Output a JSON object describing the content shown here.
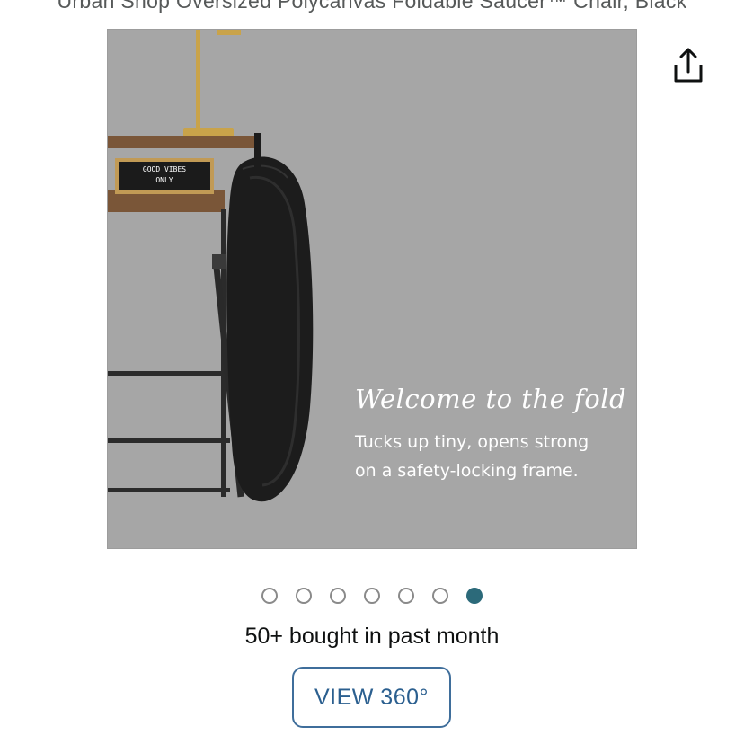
{
  "product": {
    "title": "Urban Shop Oversized Polycanvas Foldable Saucer™ Chair, Black"
  },
  "share": {
    "icon": "share-icon"
  },
  "image": {
    "sign_text": "GOOD VIBES ONLY",
    "overlay_heading": "Welcome to the fold",
    "overlay_line1": "Tucks up tiny, opens strong",
    "overlay_line2": "on a safety-locking frame."
  },
  "carousel": {
    "total": 7,
    "active_index": 6,
    "active_color": "#2c6a7a"
  },
  "social_proof": {
    "text": "50+ bought in past month"
  },
  "view360": {
    "label": "VIEW 360°"
  }
}
